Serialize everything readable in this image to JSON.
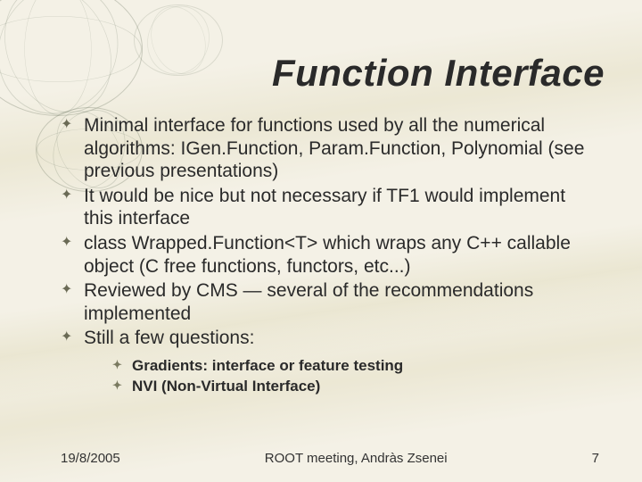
{
  "title": "Function Interface",
  "bullets": [
    "Minimal interface for functions used by all the numerical algorithms: IGen.Function, Param.Function, Polynomial (see previous presentations)",
    "It would be nice but not necessary if TF1 would implement this interface",
    "class Wrapped.Function<T> which wraps any C++ callable object (C free functions, functors, etc...)",
    "Reviewed by CMS — several of the recommendations implemented",
    "Still a few questions:"
  ],
  "sub_bullets": [
    "Gradients: interface or feature testing",
    "NVI (Non-Virtual Interface)"
  ],
  "footer": {
    "date": "19/8/2005",
    "center": "ROOT meeting, Andràs Zsenei",
    "page": "7"
  }
}
